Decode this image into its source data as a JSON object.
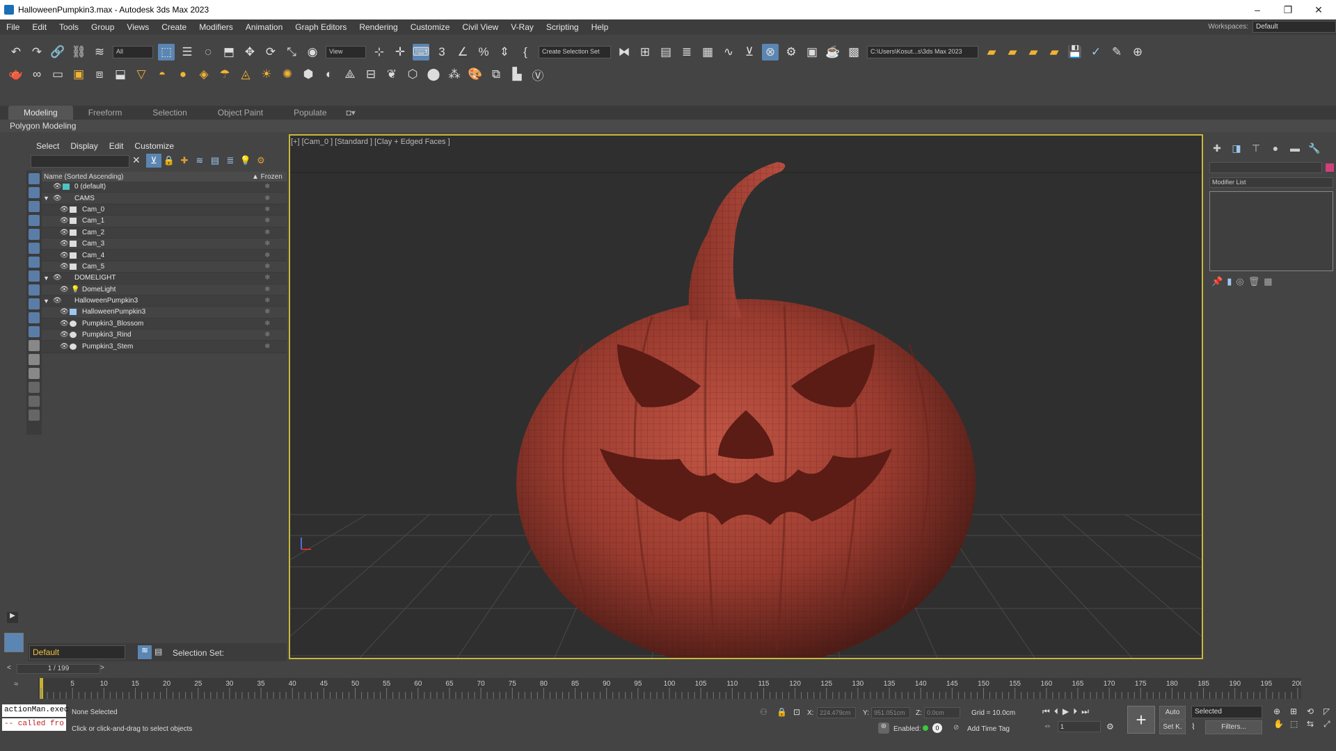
{
  "window": {
    "title": "HalloweenPumpkin3.max - Autodesk 3ds Max 2023"
  },
  "menu": [
    "File",
    "Edit",
    "Tools",
    "Group",
    "Views",
    "Create",
    "Modifiers",
    "Animation",
    "Graph Editors",
    "Rendering",
    "Customize",
    "Civil View",
    "V-Ray",
    "Scripting",
    "Help"
  ],
  "workspace": {
    "label": "Workspaces:",
    "value": "Default"
  },
  "toolbar": {
    "filter": "All",
    "ref_coord": "View",
    "selection_set": "Create Selection Set",
    "project_path": "C:\\Users\\Kosut...s\\3ds Max 2023"
  },
  "ribbon": {
    "tabs": [
      "Modeling",
      "Freeform",
      "Selection",
      "Object Paint",
      "Populate"
    ],
    "active": "Modeling",
    "panel": "Polygon Modeling"
  },
  "scene_explorer": {
    "menus": [
      "Select",
      "Display",
      "Edit",
      "Customize"
    ],
    "column_name": "Name (Sorted Ascending)",
    "column_frozen": "▲ Frozen",
    "rows": [
      {
        "name": "0 (default)",
        "level": 0,
        "type": "layer"
      },
      {
        "name": "CAMS",
        "level": 0,
        "type": "group"
      },
      {
        "name": "Cam_0",
        "level": 1,
        "type": "camera"
      },
      {
        "name": "Cam_1",
        "level": 1,
        "type": "camera"
      },
      {
        "name": "Cam_2",
        "level": 1,
        "type": "camera"
      },
      {
        "name": "Cam_3",
        "level": 1,
        "type": "camera"
      },
      {
        "name": "Cam_4",
        "level": 1,
        "type": "camera"
      },
      {
        "name": "Cam_5",
        "level": 1,
        "type": "camera"
      },
      {
        "name": "DOMELIGHT",
        "level": 0,
        "type": "group"
      },
      {
        "name": "DomeLight",
        "level": 1,
        "type": "light"
      },
      {
        "name": "HalloweenPumpkin3",
        "level": 0,
        "type": "group"
      },
      {
        "name": "HalloweenPumpkin3",
        "level": 1,
        "type": "group-object"
      },
      {
        "name": "Pumpkin3_Blossom",
        "level": 1,
        "type": "mesh"
      },
      {
        "name": "Pumpkin3_Rind",
        "level": 1,
        "type": "mesh"
      },
      {
        "name": "Pumpkin3_Stem",
        "level": 1,
        "type": "mesh"
      }
    ],
    "layer": "Default",
    "selection_set_label": "Selection Set:"
  },
  "viewport": {
    "label": "[+] [Cam_0 ] [Standard ] [Clay + Edged Faces ]"
  },
  "command_panel": {
    "modifier_list": "Modifier List"
  },
  "timeline": {
    "frame": "1 / 199",
    "ticks": [
      5,
      10,
      15,
      20,
      25,
      30,
      35,
      40,
      45,
      50,
      55,
      60,
      65,
      70,
      75,
      80,
      85,
      90,
      95,
      100,
      105,
      110,
      115,
      120,
      125,
      130,
      135,
      140,
      145,
      150,
      155,
      160,
      165,
      170,
      175,
      180,
      185,
      190,
      195,
      200
    ]
  },
  "status": {
    "maxscript_1": "actionMan.exec",
    "maxscript_2": "-- called fro",
    "line1": "None Selected",
    "line2": "Click or click-and-drag to select objects",
    "x_label": "X:",
    "x_value": "224.479cm",
    "y_label": "Y:",
    "y_value": "951.051cm",
    "z_label": "Z:",
    "z_value": "0.0cm",
    "grid": "Grid = 10.0cm",
    "enabled_label": "Enabled:",
    "add_time_tag": "Add Time Tag",
    "auto": "Auto",
    "set_key": "Set K.",
    "selected": "Selected",
    "filters": "Filters...",
    "frame_field": "1"
  }
}
